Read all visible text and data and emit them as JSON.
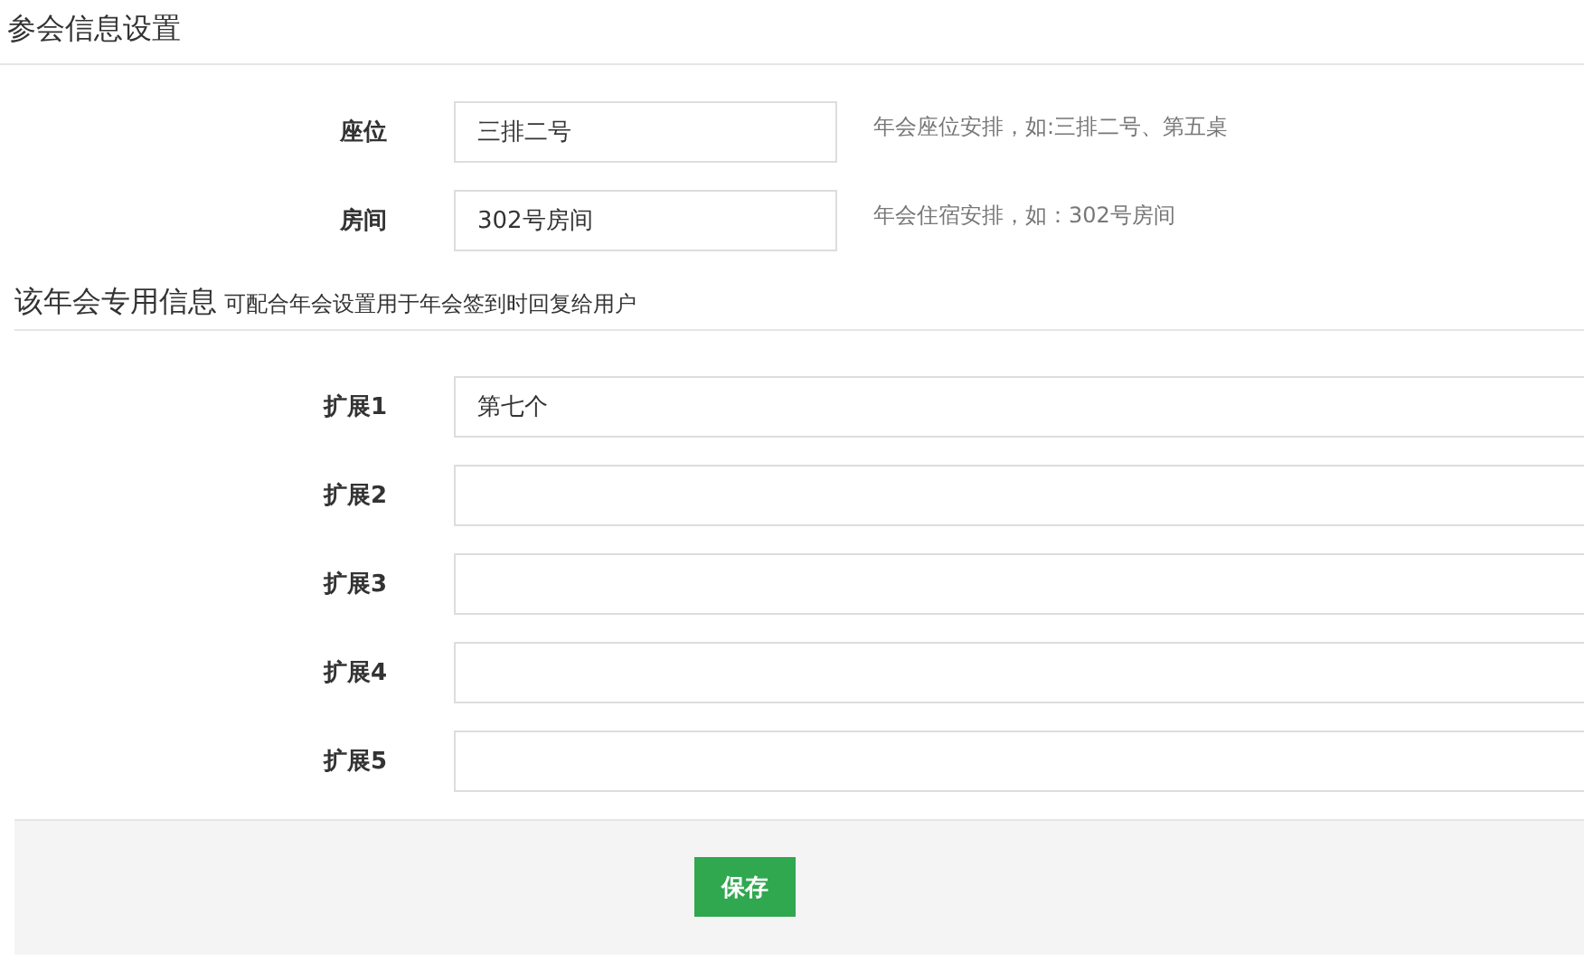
{
  "title": "参会信息设置",
  "fields": [
    {
      "label": "座位",
      "value": "三排二号",
      "hint": "年会座位安排，如:三排二号、第五桌"
    },
    {
      "label": "房间",
      "value": "302号房间",
      "hint": "年会住宿安排，如：302号房间"
    }
  ],
  "section": {
    "title": "该年会专用信息",
    "subtitle": "可配合年会设置用于年会签到时回复给用户"
  },
  "extensions": [
    {
      "label": "扩展1",
      "value": "第七个"
    },
    {
      "label": "扩展2"
    },
    {
      "label": "扩展3"
    },
    {
      "label": "扩展4"
    },
    {
      "label": "扩展5"
    }
  ],
  "save_button": "保存"
}
